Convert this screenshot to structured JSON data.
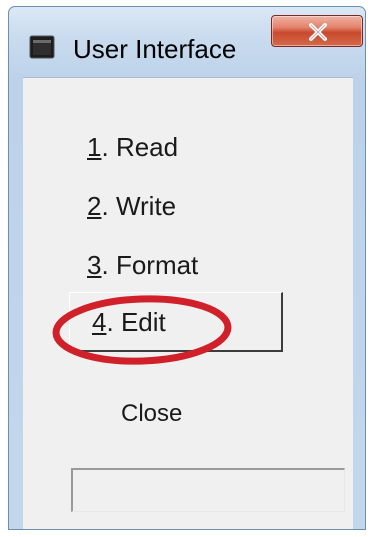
{
  "window": {
    "title": "User Interface",
    "icon": "app-window-icon",
    "close_icon": "close-icon"
  },
  "menu": {
    "items": [
      {
        "number": "1",
        "label": "Read"
      },
      {
        "number": "2",
        "label": "Write"
      },
      {
        "number": "3",
        "label": "Format"
      },
      {
        "number": "4",
        "label": "Edit"
      }
    ],
    "close_label": "Close"
  },
  "status": {
    "value": ""
  },
  "colors": {
    "highlight_ring": "#d0202a",
    "close_button": "#c94a2e"
  }
}
